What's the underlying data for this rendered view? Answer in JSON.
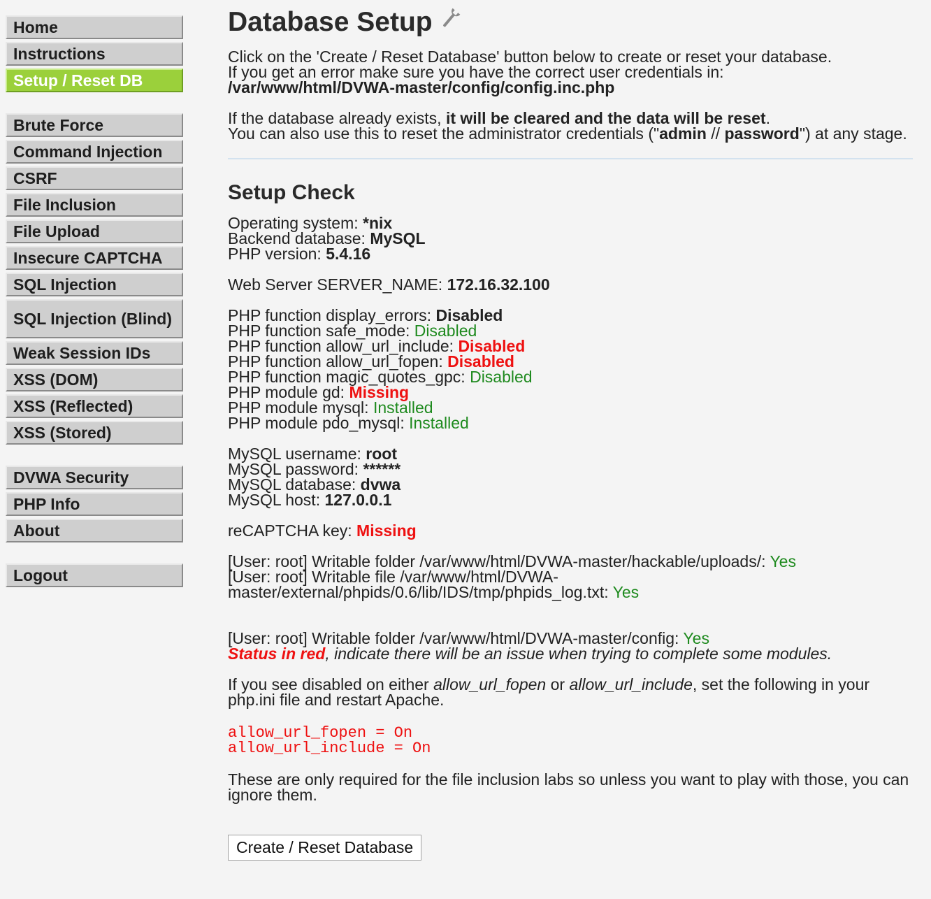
{
  "sidebar": {
    "group1": [
      {
        "label": "Home"
      },
      {
        "label": "Instructions"
      },
      {
        "label": "Setup / Reset DB"
      }
    ],
    "group2": [
      {
        "label": "Brute Force"
      },
      {
        "label": "Command Injection"
      },
      {
        "label": "CSRF"
      },
      {
        "label": "File Inclusion"
      },
      {
        "label": "File Upload"
      },
      {
        "label": "Insecure CAPTCHA"
      },
      {
        "label": "SQL Injection"
      },
      {
        "label": "SQL Injection (Blind)"
      },
      {
        "label": "Weak Session IDs"
      },
      {
        "label": "XSS (DOM)"
      },
      {
        "label": "XSS (Reflected)"
      },
      {
        "label": "XSS (Stored)"
      }
    ],
    "group3": [
      {
        "label": "DVWA Security"
      },
      {
        "label": "PHP Info"
      },
      {
        "label": "About"
      }
    ],
    "group4": [
      {
        "label": "Logout"
      }
    ]
  },
  "main": {
    "title": "Database Setup",
    "intro": {
      "line1": "Click on the 'Create / Reset Database' button below to create or reset your database.",
      "line2": "If you get an error make sure you have the correct user credentials in:",
      "config_path": "/var/www/html/DVWA-master/config/config.inc.php",
      "line3_pre": "If the database already exists, ",
      "line3_bold": "it will be cleared and the data will be reset",
      "line3_post": ".",
      "line4_pre": "You can also use this to reset the administrator credentials (\"",
      "line4_user": "admin",
      "line4_sep": " // ",
      "line4_pass": "password",
      "line4_post": "\") at any stage."
    },
    "setup_check": {
      "heading": "Setup Check",
      "os_label": "Operating system: ",
      "os_value": "*nix",
      "db_label": "Backend database: ",
      "db_value": "MySQL",
      "php_label": "PHP version: ",
      "php_value": "5.4.16",
      "server_label": "Web Server SERVER_NAME: ",
      "server_value": "172.16.32.100",
      "display_errors_label": "PHP function display_errors: ",
      "display_errors_value": "Disabled",
      "safe_mode_label": "PHP function safe_mode: ",
      "safe_mode_value": "Disabled",
      "allow_url_include_label": "PHP function allow_url_include: ",
      "allow_url_include_value": "Disabled",
      "allow_url_fopen_label": "PHP function allow_url_fopen: ",
      "allow_url_fopen_value": "Disabled",
      "magic_quotes_label": "PHP function magic_quotes_gpc: ",
      "magic_quotes_value": "Disabled",
      "gd_label": "PHP module gd: ",
      "gd_value": "Missing",
      "mysql_label": "PHP module mysql: ",
      "mysql_value": "Installed",
      "pdo_label": "PHP module pdo_mysql: ",
      "pdo_value": "Installed",
      "mysql_user_label": "MySQL username: ",
      "mysql_user_value": "root",
      "mysql_pass_label": "MySQL password: ",
      "mysql_pass_value": "******",
      "mysql_db_label": "MySQL database: ",
      "mysql_db_value": "dvwa",
      "mysql_host_label": "MySQL host: ",
      "mysql_host_value": "127.0.0.1",
      "recaptcha_label": "reCAPTCHA key: ",
      "recaptcha_value": "Missing",
      "writable1_label": "[User: root] Writable folder /var/www/html/DVWA-master/hackable/uploads/: ",
      "writable1_value": "Yes",
      "writable2_label": "[User: root] Writable file /var/www/html/DVWA-master/external/phpids/0.6/lib/IDS/tmp/phpids_log.txt: ",
      "writable2_value": "Yes",
      "writable3_label": "[User: root] Writable folder /var/www/html/DVWA-master/config: ",
      "writable3_value": "Yes",
      "status_red": "Status in red",
      "status_rest": ", indicate there will be an issue when trying to complete some modules.",
      "disabled_pre": "If you see disabled on either ",
      "disabled_fopen": "allow_url_fopen",
      "disabled_or": " or ",
      "disabled_include": "allow_url_include",
      "disabled_post": ", set the following in your php.ini file and restart Apache.",
      "code_line1": "allow_url_fopen = On",
      "code_line2": "allow_url_include = On",
      "footer_note": "These are only required for the file inclusion labs so unless you want to play with those, you can ignore them."
    },
    "button_label": "Create / Reset Database"
  },
  "colors": {
    "selected_nav": "#9bd03b",
    "nav_bg": "#cfcfcf",
    "ok_green": "#1e8a1e",
    "error_red": "#ee1111"
  },
  "icons": {
    "title_icon": "wrench-icon"
  }
}
